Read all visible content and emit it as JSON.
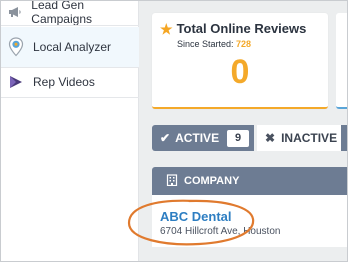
{
  "sidebar": {
    "items": [
      {
        "label": "Lead Gen Campaigns",
        "icon": "megaphone-icon"
      },
      {
        "label": "Local Analyzer",
        "icon": "location-pin-icon"
      },
      {
        "label": "Rep Videos",
        "icon": "play-icon"
      }
    ]
  },
  "reviews_card": {
    "title": "Total Online Reviews",
    "since_label": "Since Started:",
    "since_value": "728",
    "count": "0",
    "icon": "star-icon"
  },
  "filter_tabs": {
    "active_label": "ACTIVE",
    "active_count": "9",
    "inactive_label": "INACTIVE"
  },
  "table": {
    "column_header": "COMPANY",
    "rows": [
      {
        "name": "ABC Dental",
        "address": "6704 Hillcroft Ave, Houston"
      }
    ]
  },
  "colors": {
    "accent_orange": "#f4a92a",
    "header_slate": "#6d7c93",
    "link_blue": "#2d7ec2",
    "highlight_ring": "#e07a2e"
  }
}
